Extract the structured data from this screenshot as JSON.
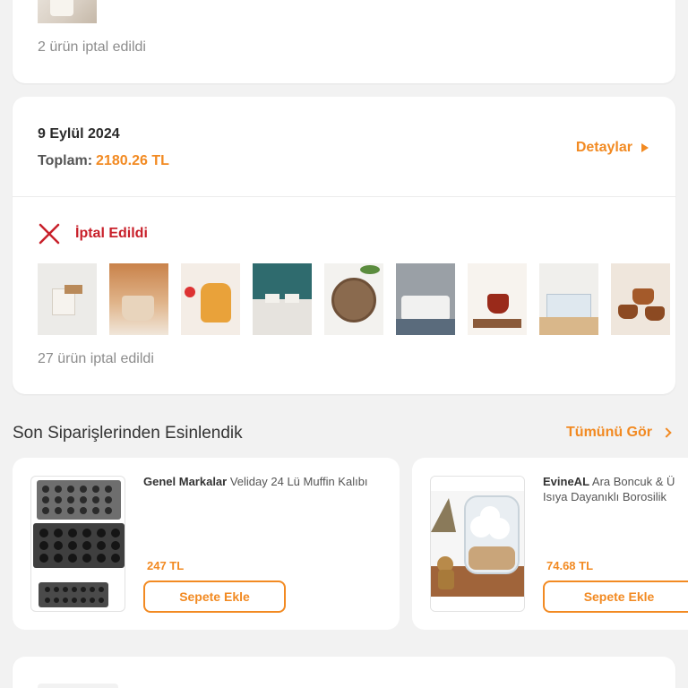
{
  "top_card": {
    "cancel_count_text": "2 ürün iptal edildi"
  },
  "order": {
    "date": "9 Eylül 2024",
    "total_label": "Toplam:",
    "total_amount": "2180.26 TL",
    "details_label": "Detaylar",
    "status_label": "İptal Edildi",
    "cancel_count_text": "27 ürün iptal edildi",
    "thumbnail_count": 9
  },
  "recommend": {
    "title": "Son Siparişlerinden Esinlendik",
    "see_all": "Tümünü Gör",
    "products": [
      {
        "brand": "Genel Markalar",
        "name": "Veliday 24 Lü Muffin Kalıbı",
        "price": "247 TL",
        "button": "Sepete Ekle"
      },
      {
        "brand": "EvineAL",
        "name": "Ara Boncuk & Ü",
        "name_line2": "Isıya Dayanıklı Borosilik",
        "price": "74.68 TL",
        "button": "Sepete Ekle"
      }
    ]
  },
  "colors": {
    "accent": "#f28a22",
    "cancel": "#c8202a",
    "background": "#f2f2f2"
  }
}
